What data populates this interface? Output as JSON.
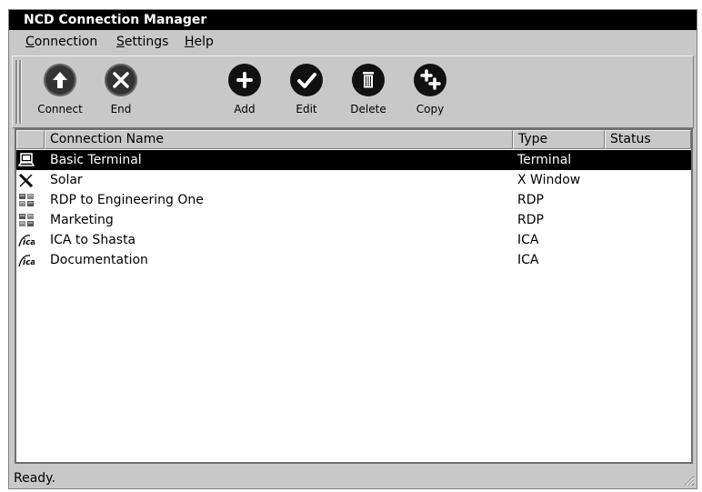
{
  "window": {
    "title": "NCD Connection Manager"
  },
  "menubar": [
    {
      "label": "Connection",
      "mnemonic": "C",
      "rest": "onnection"
    },
    {
      "label": "Settings",
      "mnemonic": "S",
      "rest": "ettings"
    },
    {
      "label": "Help",
      "mnemonic": "H",
      "rest": "elp"
    }
  ],
  "toolbar": {
    "connect": "Connect",
    "end": "End",
    "add": "Add",
    "edit": "Edit",
    "delete": "Delete",
    "copy": "Copy"
  },
  "list": {
    "columns": [
      "Connection Name",
      "Type",
      "Status"
    ],
    "rows": [
      {
        "icon": "terminal-icon",
        "name": "Basic Terminal",
        "type": "Terminal",
        "status": "",
        "selected": true
      },
      {
        "icon": "x-window-icon",
        "name": "Solar",
        "type": "X Window",
        "status": ""
      },
      {
        "icon": "rdp-icon",
        "name": "RDP to Engineering One",
        "type": "RDP",
        "status": ""
      },
      {
        "icon": "rdp-icon",
        "name": "Marketing",
        "type": "RDP",
        "status": ""
      },
      {
        "icon": "ica-icon",
        "name": "ICA to Shasta",
        "type": "ICA",
        "status": ""
      },
      {
        "icon": "ica-icon",
        "name": "Documentation",
        "type": "ICA",
        "status": ""
      }
    ]
  },
  "status": "Ready."
}
